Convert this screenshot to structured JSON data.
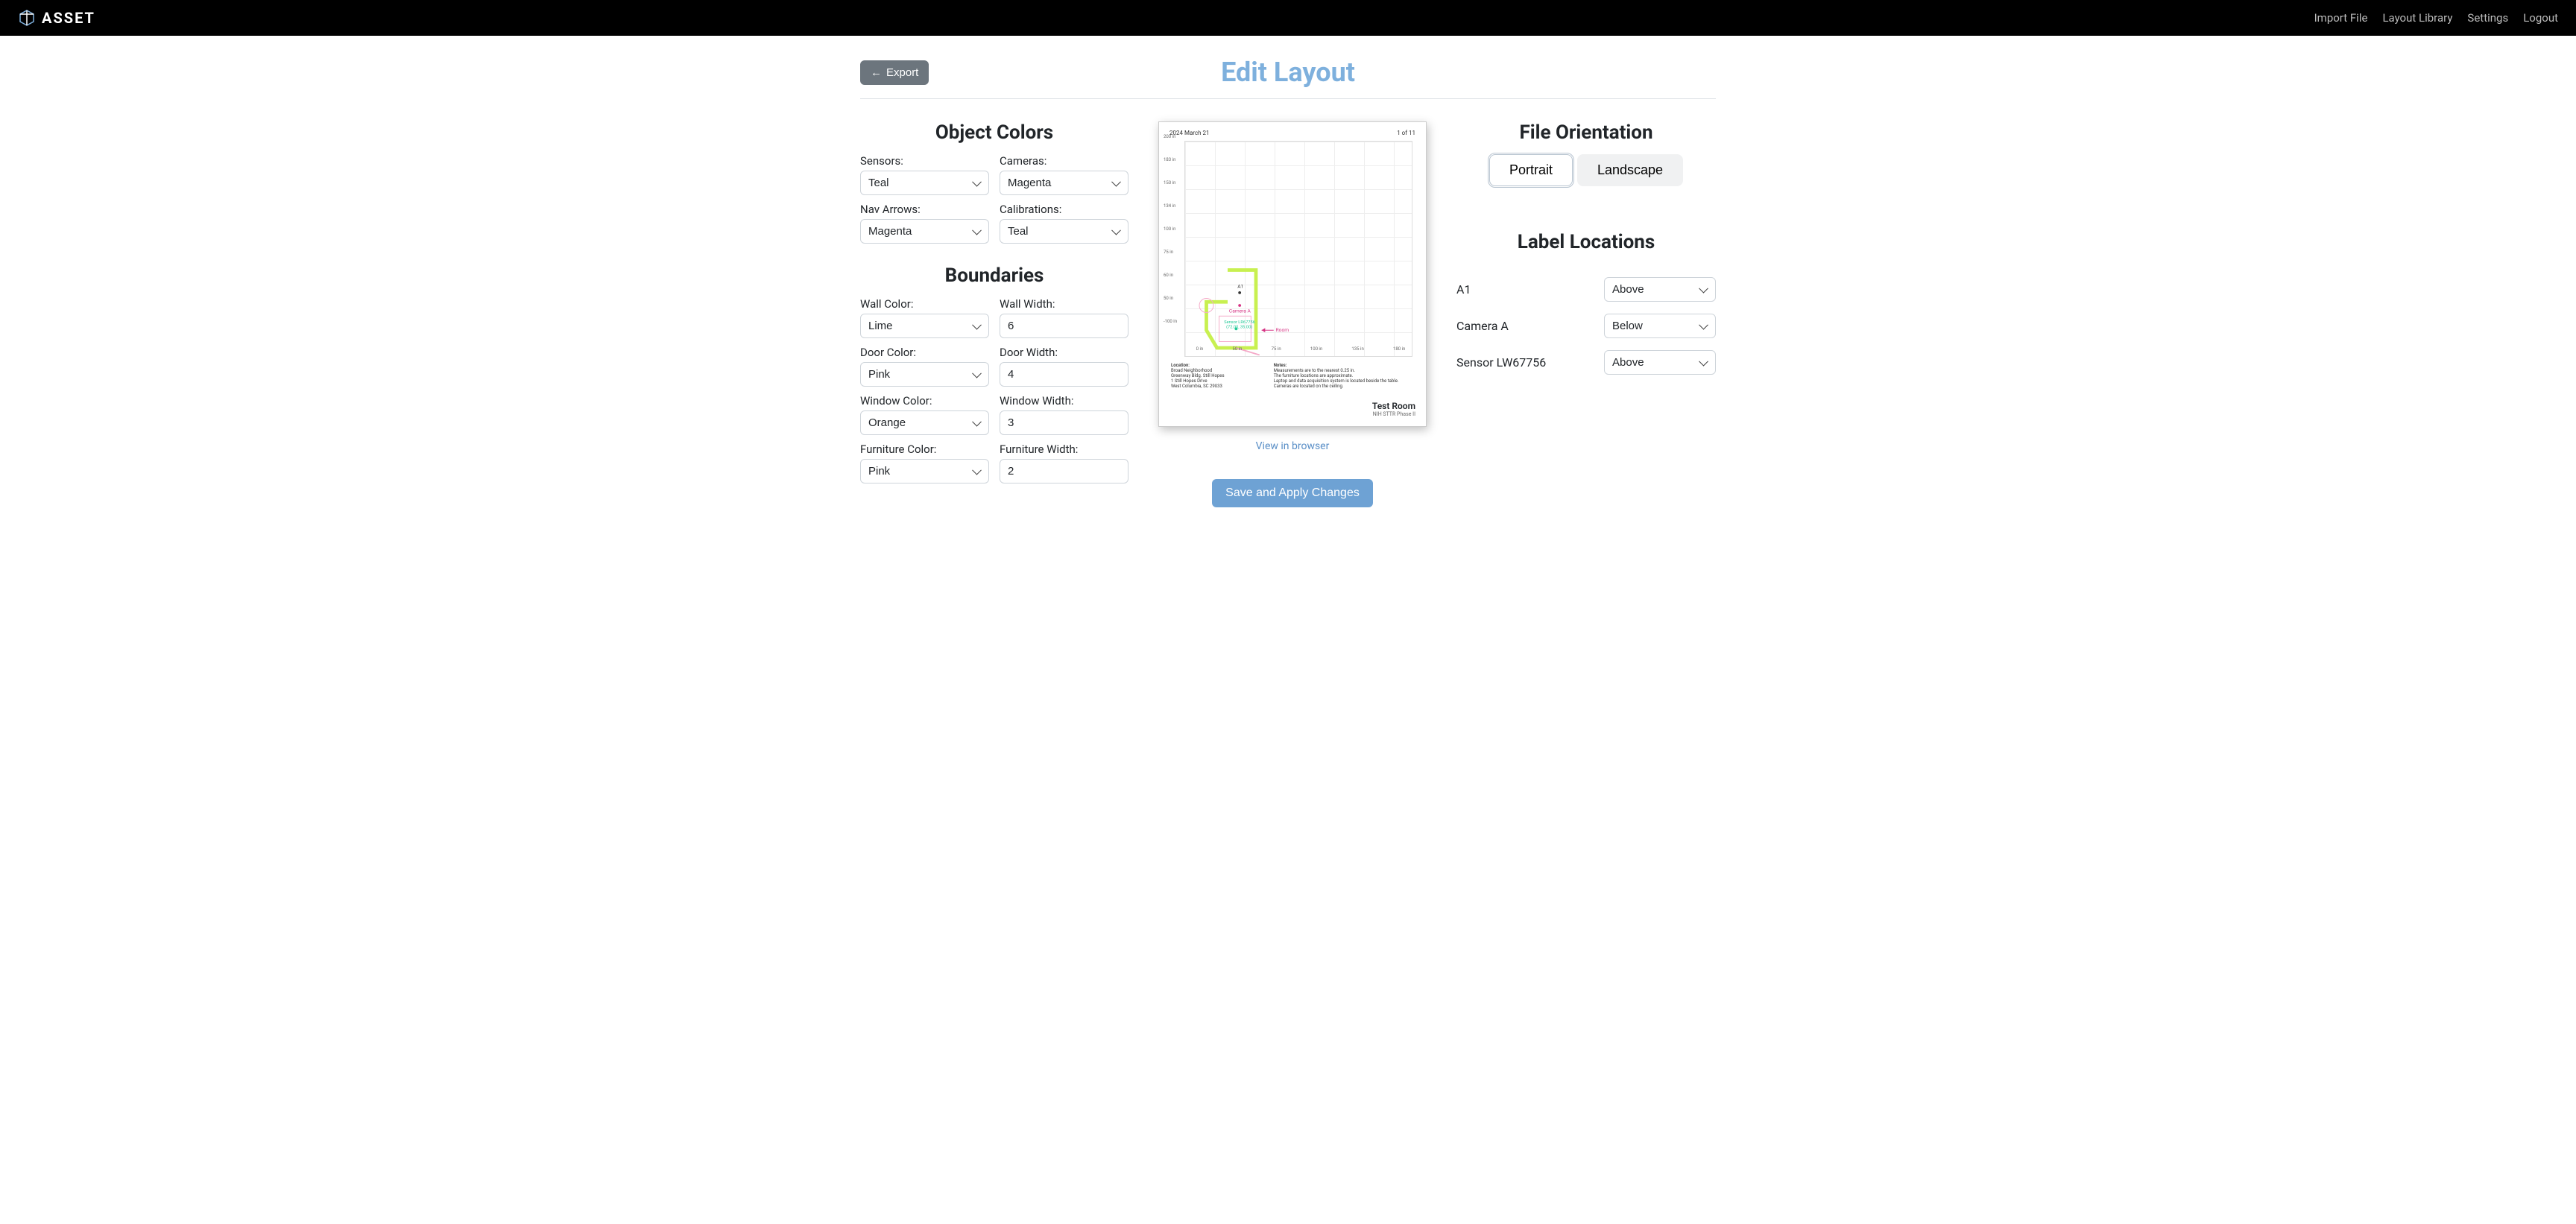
{
  "brand": "ASSET",
  "nav": {
    "import": "Import File",
    "library": "Layout Library",
    "settings": "Settings",
    "logout": "Logout"
  },
  "header": {
    "export": "Export",
    "title": "Edit Layout"
  },
  "objectColors": {
    "title": "Object Colors",
    "sensors": {
      "label": "Sensors:",
      "value": "Teal"
    },
    "cameras": {
      "label": "Cameras:",
      "value": "Magenta"
    },
    "navArrows": {
      "label": "Nav Arrows:",
      "value": "Magenta"
    },
    "calibrations": {
      "label": "Calibrations:",
      "value": "Teal"
    }
  },
  "boundaries": {
    "title": "Boundaries",
    "wallColor": {
      "label": "Wall Color:",
      "value": "Lime"
    },
    "wallWidth": {
      "label": "Wall Width:",
      "value": "6"
    },
    "doorColor": {
      "label": "Door Color:",
      "value": "Pink"
    },
    "doorWidth": {
      "label": "Door Width:",
      "value": "4"
    },
    "windowColor": {
      "label": "Window Color:",
      "value": "Orange"
    },
    "windowWidth": {
      "label": "Window Width:",
      "value": "3"
    },
    "furnitureColor": {
      "label": "Furniture Color:",
      "value": "Pink"
    },
    "furnitureWidth": {
      "label": "Furniture Width:",
      "value": "2"
    }
  },
  "preview": {
    "date": "2024 March 21",
    "page": "1 of 11",
    "yTicks": [
      "200 in",
      "183 in",
      "150 in",
      "134 in",
      "100 in",
      "75 in",
      "60 in",
      "50 in",
      "-100 in"
    ],
    "xTicks": [
      "0 in",
      "50 in",
      "75 in",
      "100 in",
      "135 in",
      "180 in"
    ],
    "labels": {
      "a1": "A1",
      "camera": "Camera A",
      "sensor": "Sensor LR67756",
      "sensorCoord": "(72.00, 35.00)",
      "room": "Room"
    },
    "footer": {
      "locationTitle": "Location:",
      "location": "Broad Neighborhood\nGreenway Bldg. Still Hopes\n1 Still Hopes Drive\nWest Columbia, SC 29033",
      "notesTitle": "Notes:",
      "notes": "Measurements are to the nearest 0.25 in.\nThe furniture locations are approximate.\nLaptop and data acquisition system is located beside the table.\nCameras are located on the ceiling."
    },
    "roomTitle": "Test Room",
    "roomSub": "NIH STTR Phase II"
  },
  "viewLink": "View in browser",
  "saveBtn": "Save and Apply Changes",
  "orientation": {
    "title": "File Orientation",
    "portrait": "Portrait",
    "landscape": "Landscape"
  },
  "labelLocations": {
    "title": "Label Locations",
    "items": [
      {
        "name": "A1",
        "value": "Above"
      },
      {
        "name": "Camera A",
        "value": "Below"
      },
      {
        "name": "Sensor LW67756",
        "value": "Above"
      }
    ]
  }
}
